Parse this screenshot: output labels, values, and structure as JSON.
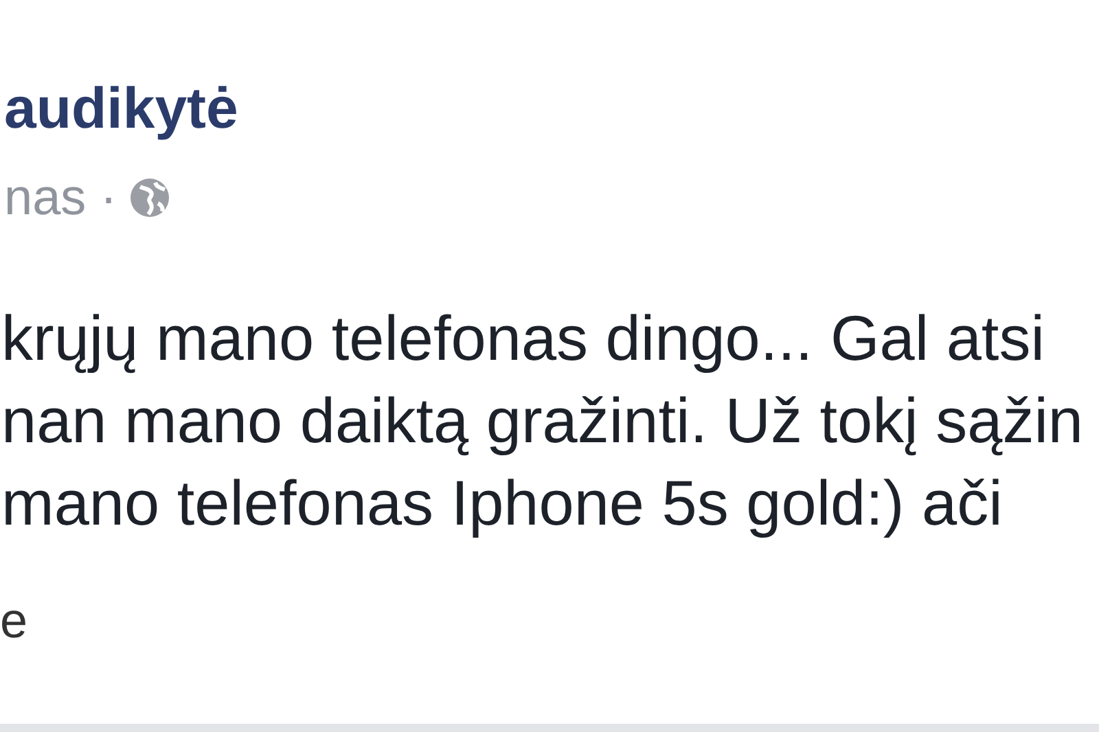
{
  "post": {
    "author": "audikytė",
    "meta": "nas ·",
    "body_lines": [
      "krųjų mano telefonas dingo... Gal atsi",
      "nan mano daiktą gražinti. Už tokį sąžin",
      "mano telefonas Iphone 5s gold:) ači"
    ],
    "footer": "e"
  }
}
